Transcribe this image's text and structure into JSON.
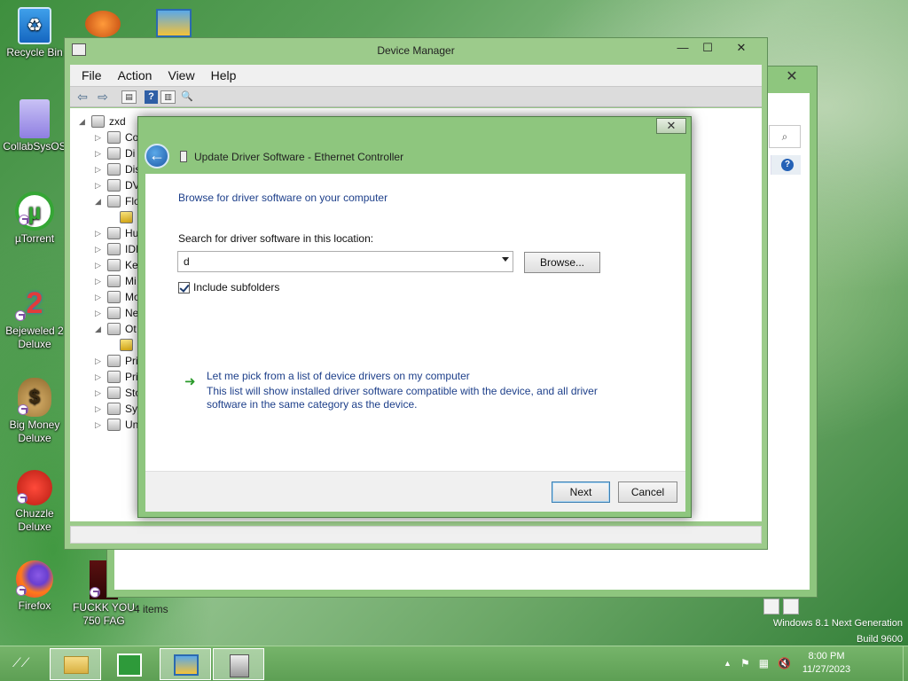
{
  "desktop": {
    "icons": [
      {
        "label": "Recycle Bin",
        "icon": "recycle-bin-icon"
      },
      {
        "label": "CollabSysOS",
        "icon": "folder-icon"
      },
      {
        "label": "µTorrent",
        "icon": "utorrent-icon"
      },
      {
        "label": "Bejeweled 2 Deluxe",
        "icon": "bejeweled-icon"
      },
      {
        "label": "Big Money Deluxe",
        "icon": "money-bag-icon"
      },
      {
        "label": "Chuzzle Deluxe",
        "icon": "chuzzle-icon"
      },
      {
        "label": "Firefox",
        "icon": "firefox-icon"
      },
      {
        "label": "FUCKK YOU 750 FAG",
        "icon": "document-icon"
      }
    ]
  },
  "bg_window": {
    "status": "4 items",
    "close_glyph": "✕",
    "search_glyph": "⌕",
    "help_glyph": "?"
  },
  "device_manager": {
    "title": "Device Manager",
    "menu": [
      "File",
      "Action",
      "View",
      "Help"
    ],
    "window_buttons": {
      "minimize": "—",
      "maximize": "☐",
      "close": "✕"
    },
    "toolbar": {
      "back": "⇦",
      "forward": "⇨",
      "properties": "▤",
      "help": "?",
      "view": "▥",
      "scan": "🔍"
    },
    "tree": {
      "root": "zxd",
      "items": [
        "Co",
        "Di",
        "Dis",
        "DV",
        "Flo",
        "",
        "Hu",
        "IDI",
        "Ke",
        "Mi",
        "Mo",
        "Ne",
        "Ot",
        "",
        "Pri",
        "Pri",
        "Sto",
        "Sy",
        "Un"
      ]
    }
  },
  "dialog": {
    "close_glyph": "✕",
    "back_glyph": "←",
    "title": "Update Driver Software - Ethernet Controller",
    "heading": "Browse for driver software on your computer",
    "search_label": "Search for driver software in this location:",
    "path_value": "d",
    "browse_label": "Browse...",
    "include_subfolders": "Include subfolders",
    "pick_arrow": "➜",
    "pick_title": "Let me pick from a list of device drivers on my computer",
    "pick_desc": "This list will show installed driver software compatible with the device, and all driver software in the same category as the device.",
    "next_label": "Next",
    "cancel_label": "Cancel"
  },
  "taskbar": {
    "start_glyph": "⟋⟋",
    "time": "8:00 PM",
    "date": "11/27/2023",
    "tray": {
      "chevron": "▲",
      "flag": "⚑",
      "network": "▦",
      "volume": "🔇"
    }
  },
  "watermark": {
    "line1": "Windows 8.1 Next Generation",
    "line2": "Build 9600"
  }
}
